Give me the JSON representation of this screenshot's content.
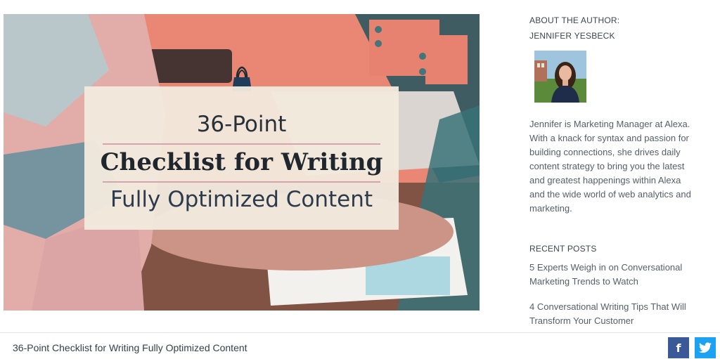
{
  "hero": {
    "title_line1": "36-Point",
    "title_line2": "Checklist for Writing",
    "title_line3": "Fully Optimized Content"
  },
  "sidebar": {
    "about_heading": "ABOUT THE AUTHOR:",
    "author_name": "JENNIFER YESBECK",
    "author_bio": "Jennifer is Marketing Manager at Alexa. With a knack for syntax and passion for building connections, she drives daily content strategy to bring you the latest and greatest happenings within Alexa and the wide world of web analytics and marketing.",
    "recent_heading": "RECENT POSTS",
    "recent_posts": [
      "5 Experts Weigh in on Conversational Marketing Trends to Watch",
      "4 Conversational Writing Tips That Will Transform Your Customer"
    ]
  },
  "footer": {
    "caption": "36-Point Checklist for Writing Fully Optimized Content",
    "share_icons": [
      "facebook-icon",
      "twitter-icon"
    ]
  },
  "colors": {
    "facebook": "#3b5998",
    "twitter": "#1da1f2",
    "card_bg": "#f1e9dd",
    "overlay_coral": "#f07a68"
  }
}
